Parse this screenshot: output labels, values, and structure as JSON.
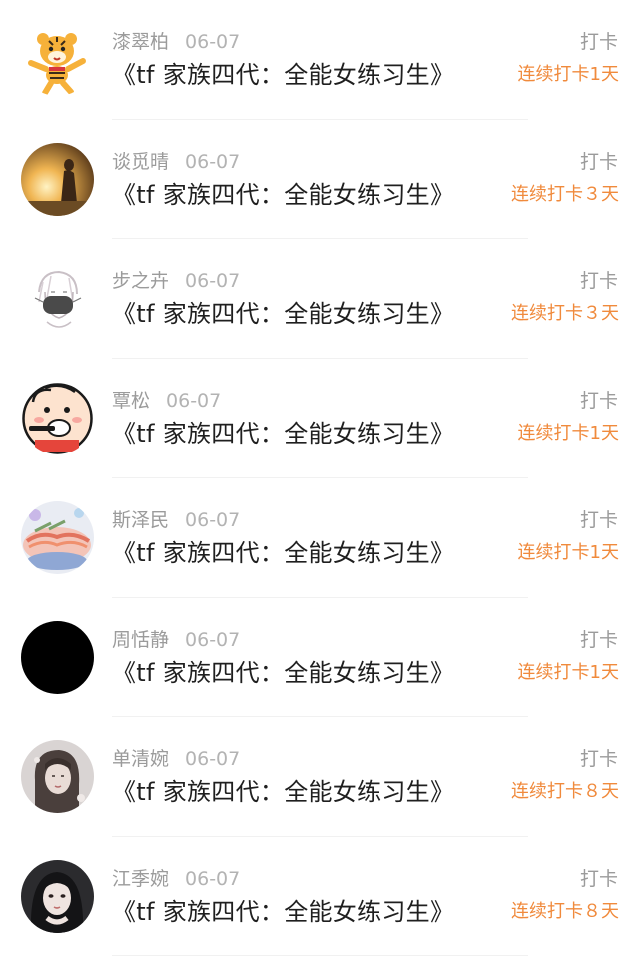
{
  "items": [
    {
      "name": "漆翠柏",
      "date": "06-07",
      "title": "《tf 家族四代：全能女练习生》",
      "action": "打卡",
      "streak": "连续打卡1天",
      "avatar": "tiger-cartoon-avatar"
    },
    {
      "name": "谈觅晴",
      "date": "06-07",
      "title": "《tf 家族四代：全能女练习生》",
      "action": "打卡",
      "streak": "连续打卡３天",
      "avatar": "sunset-silhouette-avatar"
    },
    {
      "name": "步之卉",
      "date": "06-07",
      "title": "《tf 家族四代：全能女练习生》",
      "action": "打卡",
      "streak": "连续打卡３天",
      "avatar": "masked-sketch-avatar"
    },
    {
      "name": "覃松",
      "date": "06-07",
      "title": "《tf 家族四代：全能女练习生》",
      "action": "打卡",
      "streak": "连续打卡1天",
      "avatar": "brushing-teeth-cartoon-avatar"
    },
    {
      "name": "斯泽民",
      "date": "06-07",
      "title": "《tf 家族四代：全能女练习生》",
      "action": "打卡",
      "streak": "连续打卡1天",
      "avatar": "food-illustration-avatar"
    },
    {
      "name": "周恬静",
      "date": "06-07",
      "title": "《tf 家族四代：全能女练习生》",
      "action": "打卡",
      "streak": "连续打卡1天",
      "avatar": "black-avatar"
    },
    {
      "name": "单清婉",
      "date": "06-07",
      "title": "《tf 家族四代：全能女练习生》",
      "action": "打卡",
      "streak": "连续打卡８天",
      "avatar": "girl-portrait-avatar"
    },
    {
      "name": "江季婉",
      "date": "06-07",
      "title": "《tf 家族四代：全能女练习生》",
      "action": "打卡",
      "streak": "连续打卡８天",
      "avatar": "dark-hair-girl-avatar"
    }
  ],
  "colors": {
    "name": "#9b9b9b",
    "date": "#b3b3b3",
    "title": "#1f1f1f",
    "streak": "#f08a3c",
    "divider": "#f1f1f1"
  }
}
